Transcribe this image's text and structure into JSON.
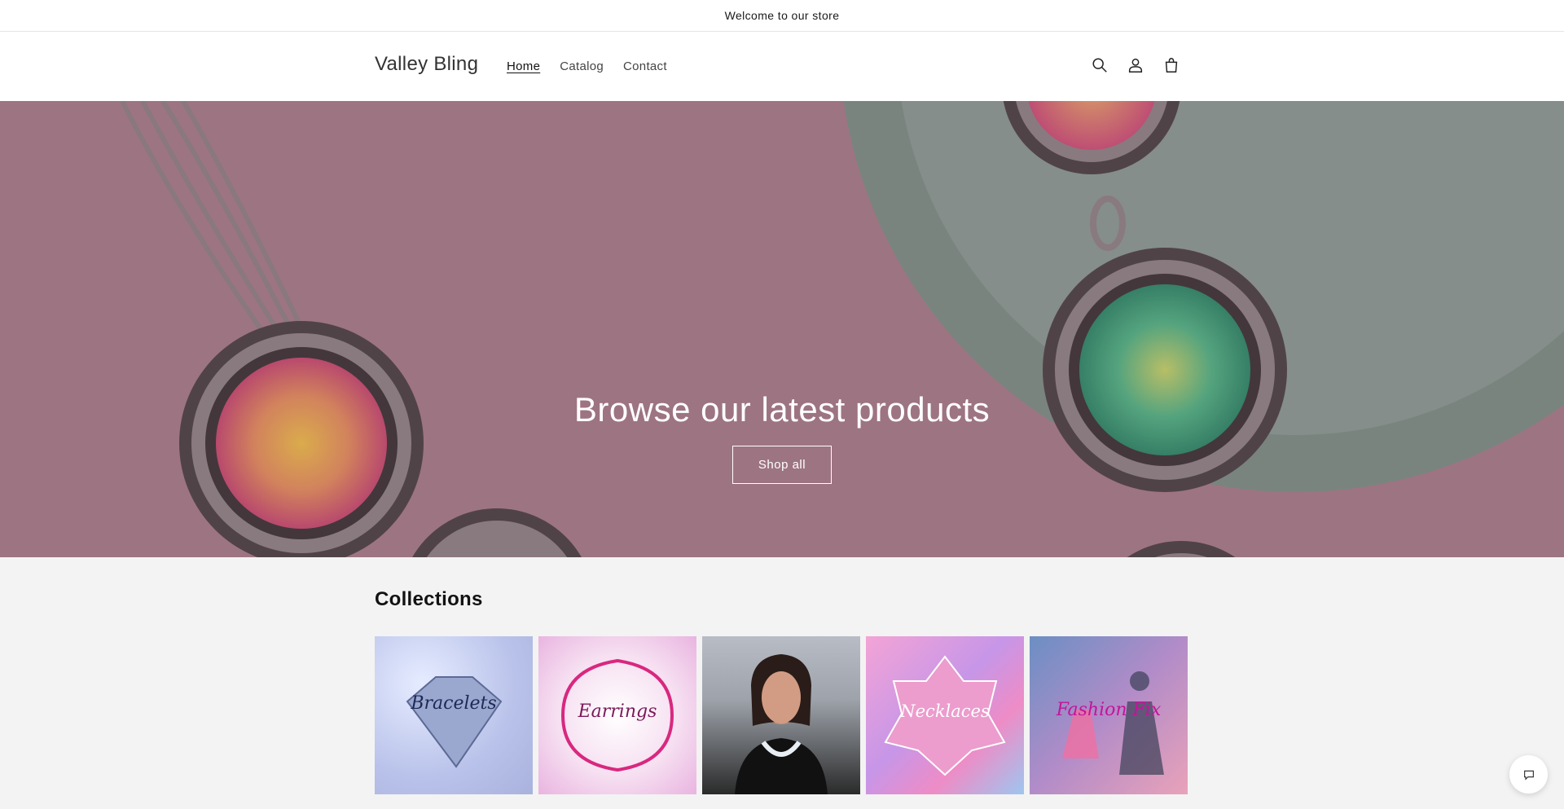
{
  "announcement": {
    "text": "Welcome to our store"
  },
  "header": {
    "logo": "Valley Bling",
    "nav": [
      {
        "label": "Home",
        "active": true
      },
      {
        "label": "Catalog",
        "active": false
      },
      {
        "label": "Contact",
        "active": false
      }
    ],
    "icons": [
      "search-icon",
      "account-icon",
      "cart-icon"
    ]
  },
  "hero": {
    "title": "Browse our latest products",
    "button_label": "Shop all"
  },
  "collections": {
    "title": "Collections",
    "items": [
      {
        "label": "Bracelets"
      },
      {
        "label": "Earrings"
      },
      {
        "label": ""
      },
      {
        "label": "Necklaces"
      },
      {
        "label": "Fashion Fix"
      }
    ]
  },
  "chat": {
    "icon": "chat-icon"
  },
  "colors": {
    "hero_overlay": "#b08693",
    "background": "#f3f3f3",
    "accent_mint": "#8fb3a6"
  }
}
